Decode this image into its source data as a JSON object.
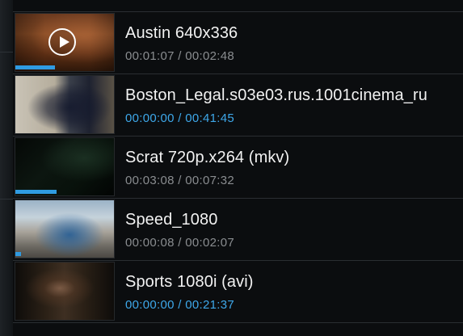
{
  "videos": [
    {
      "title": "Austin 640x336",
      "time": "00:01:07 / 00:02:48",
      "played_fraction": 0.4,
      "active": false
    },
    {
      "title": "Boston_Legal.s03e03.rus.1001cinema_ru",
      "time": "00:00:00 / 00:41:45",
      "played_fraction": 0,
      "active": true
    },
    {
      "title": "Scrat 720p.x264 (mkv)",
      "time": "00:03:08 / 00:07:32",
      "played_fraction": 0.42,
      "active": false
    },
    {
      "title": "Speed_1080",
      "time": "00:00:08 / 00:02:07",
      "played_fraction": 0.06,
      "active": false
    },
    {
      "title": "Sports 1080i (avi)",
      "time": "00:00:00 / 00:21:37",
      "played_fraction": 0,
      "active": true
    }
  ],
  "colors": {
    "accent": "#2f9be2",
    "active_time": "#3ea8ea",
    "inactive_time": "#8a8d90",
    "title": "#f2f2f2"
  },
  "icons": {
    "play": "play-circle-icon"
  }
}
